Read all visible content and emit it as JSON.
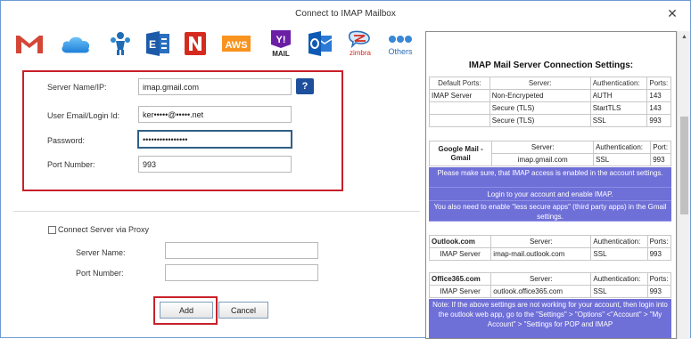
{
  "window": {
    "title": "Connect to IMAP Mailbox",
    "close_label": "✕"
  },
  "providers": [
    {
      "name": "gmail-icon",
      "label": ""
    },
    {
      "name": "icloud-icon",
      "label": ""
    },
    {
      "name": "ibm-icon",
      "label": ""
    },
    {
      "name": "exchange-icon",
      "label": ""
    },
    {
      "name": "netease-icon",
      "label": ""
    },
    {
      "name": "aws-icon",
      "label": "AWS"
    },
    {
      "name": "yahoo-icon",
      "label": "MAIL"
    },
    {
      "name": "outlook-icon",
      "label": ""
    },
    {
      "name": "zimbra-icon",
      "label": "zimbra"
    },
    {
      "name": "others-icon",
      "label": "Others"
    }
  ],
  "form": {
    "server_label": "Server Name/IP:",
    "server_value": "imap.gmail.com",
    "email_label": "User Email/Login Id:",
    "email_value": "ker•••••@•••••.net",
    "password_label": "Password:",
    "password_value": "••••••••••••••••",
    "port_label": "Port Number:",
    "port_value": "993",
    "help_label": "?"
  },
  "proxy": {
    "checkbox_label": "Connect Server via Proxy",
    "server_label": "Server Name:",
    "server_value": "",
    "port_label": "Port Number:",
    "port_value": ""
  },
  "buttons": {
    "add": "Add",
    "cancel": "Cancel"
  },
  "settings": {
    "title": "IMAP Mail Server Connection Settings:",
    "imap": {
      "headers": [
        "Default Ports:",
        "Server:",
        "Authentication:",
        "Ports:"
      ],
      "rows": [
        [
          "IMAP Server",
          "Non-Encrypeted",
          "AUTH",
          "143"
        ],
        [
          "",
          "Secure (TLS)",
          "StartTLS",
          "143"
        ],
        [
          "",
          "Secure (TLS)",
          "SSL",
          "993"
        ]
      ]
    },
    "gmail": {
      "name": "Google Mail - Gmail",
      "headers": [
        "Server:",
        "Authentication:",
        "Port:"
      ],
      "row": [
        "imap.gmail.com",
        "SSL",
        "993"
      ],
      "notes": [
        "Please make sure, that IMAP access is enabled in the account settings.",
        "Login to your account and enable IMAP.",
        "You also need to enable \"less secure apps\" (third party apps) in the Gmail settings."
      ]
    },
    "outlook": {
      "name": "Outlook.com",
      "headers": [
        "Server:",
        "Authentication:",
        "Ports:"
      ],
      "row": [
        "IMAP Server",
        "imap-mail.outlook.com",
        "SSL",
        "993"
      ]
    },
    "office365": {
      "name": "Office365.com",
      "headers": [
        "Server:",
        "Authentication:",
        "Ports:"
      ],
      "row": [
        "IMAP Server",
        "outlook.office365.com",
        "SSL",
        "993"
      ],
      "note": "Note: If the above settings are not working for your account, then login into the outlook web app, go to the \"Settings\" > \"Options\" <\"Account\" > \"My Account\" > \"Settings for POP and IMAP"
    }
  }
}
